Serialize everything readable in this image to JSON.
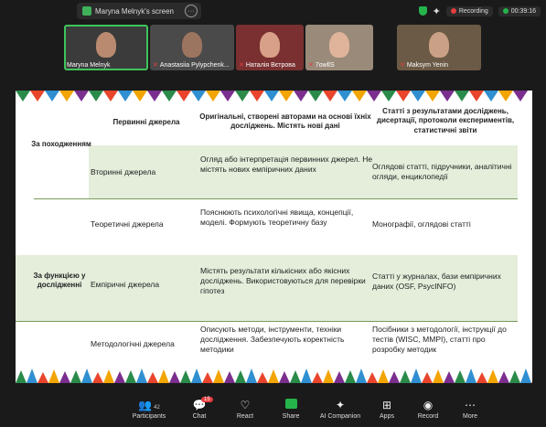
{
  "topbar": {
    "share_label": "Maryna Melnyk's screen",
    "more": "···",
    "recording_label": "Recording",
    "timer": "00:39:16"
  },
  "participants": [
    {
      "name": "Maryna Melnyk",
      "muted": false,
      "active": true
    },
    {
      "name": "Anastasiia Pylypchenk...",
      "muted": true,
      "active": false
    },
    {
      "name": "Наталія Вєтрова",
      "muted": true,
      "active": false
    },
    {
      "name": "7owllS",
      "muted": true,
      "active": false
    },
    {
      "name": "Maksym Yenin",
      "muted": true,
      "active": false
    }
  ],
  "table": {
    "headers": [
      "Первинні джерела",
      "Оригінальні, створені авторами на основі їхніх досліджень. Містять нові дані",
      "Статті з результатами досліджень, дисертації, протоколи експериментів, статистичні звіти"
    ],
    "groups": [
      "За походженням",
      "За функцією у дослідженні"
    ],
    "rows": [
      {
        "name": "Вторинні джерела",
        "description": "Огляд або інтерпретація первинних джерел. Не містять нових емпіричних даних",
        "examples": "Оглядові статті, підручники, аналітичні огляди, енциклопедії"
      },
      {
        "name": "Теоретичні джерела",
        "description": "Пояснюють психологічні явища, концепції, моделі. Формують теоретичну базу",
        "examples": "Монографії, оглядові статті"
      },
      {
        "name": "Емпіричні джерела",
        "description": "Містять результати кількісних або якісних досліджень. Використовуються для перевірки гіпотез",
        "examples": "Статті у журналах, бази емпіричних даних (OSF, PsycINFO)"
      },
      {
        "name": "Методологічні джерела",
        "description": "Описують методи, інструменти, техніки дослідження. Забезпечують коректність методики",
        "examples": "Посібники з методології, інструкції до тестів (WISC, MMPI), статті про розробку методик"
      }
    ]
  },
  "toolbar": {
    "participants_label": "Participants",
    "participants_count": "42",
    "chat_label": "Chat",
    "chat_badge": "15",
    "react_label": "React",
    "share_label": "Share",
    "ai_label": "AI Companion",
    "apps_label": "Apps",
    "record_label": "Record",
    "more_label": "More"
  },
  "colors": {
    "accent_green": "#25b34b",
    "record_red": "#e43d3d",
    "table_green": "#e4eedb"
  }
}
